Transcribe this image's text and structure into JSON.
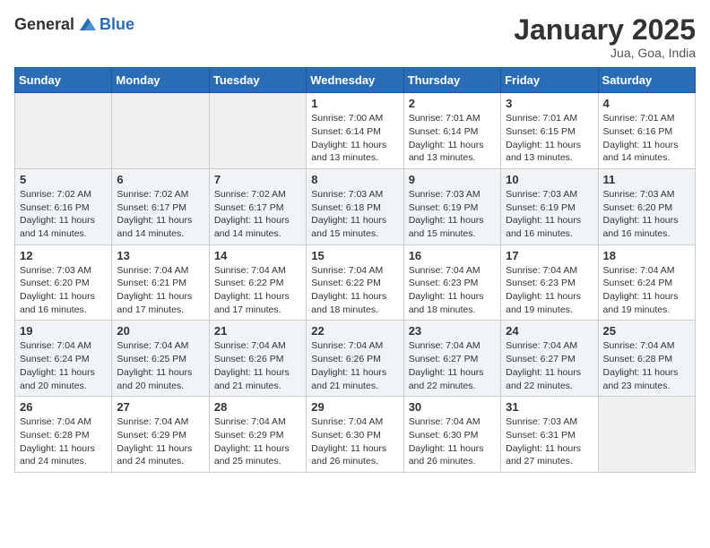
{
  "header": {
    "logo_general": "General",
    "logo_blue": "Blue",
    "month_title": "January 2025",
    "location": "Jua, Goa, India"
  },
  "columns": [
    "Sunday",
    "Monday",
    "Tuesday",
    "Wednesday",
    "Thursday",
    "Friday",
    "Saturday"
  ],
  "weeks": [
    [
      {
        "day": "",
        "sunrise": "",
        "sunset": "",
        "daylight": ""
      },
      {
        "day": "",
        "sunrise": "",
        "sunset": "",
        "daylight": ""
      },
      {
        "day": "",
        "sunrise": "",
        "sunset": "",
        "daylight": ""
      },
      {
        "day": "1",
        "sunrise": "Sunrise: 7:00 AM",
        "sunset": "Sunset: 6:14 PM",
        "daylight": "Daylight: 11 hours and 13 minutes."
      },
      {
        "day": "2",
        "sunrise": "Sunrise: 7:01 AM",
        "sunset": "Sunset: 6:14 PM",
        "daylight": "Daylight: 11 hours and 13 minutes."
      },
      {
        "day": "3",
        "sunrise": "Sunrise: 7:01 AM",
        "sunset": "Sunset: 6:15 PM",
        "daylight": "Daylight: 11 hours and 13 minutes."
      },
      {
        "day": "4",
        "sunrise": "Sunrise: 7:01 AM",
        "sunset": "Sunset: 6:16 PM",
        "daylight": "Daylight: 11 hours and 14 minutes."
      }
    ],
    [
      {
        "day": "5",
        "sunrise": "Sunrise: 7:02 AM",
        "sunset": "Sunset: 6:16 PM",
        "daylight": "Daylight: 11 hours and 14 minutes."
      },
      {
        "day": "6",
        "sunrise": "Sunrise: 7:02 AM",
        "sunset": "Sunset: 6:17 PM",
        "daylight": "Daylight: 11 hours and 14 minutes."
      },
      {
        "day": "7",
        "sunrise": "Sunrise: 7:02 AM",
        "sunset": "Sunset: 6:17 PM",
        "daylight": "Daylight: 11 hours and 14 minutes."
      },
      {
        "day": "8",
        "sunrise": "Sunrise: 7:03 AM",
        "sunset": "Sunset: 6:18 PM",
        "daylight": "Daylight: 11 hours and 15 minutes."
      },
      {
        "day": "9",
        "sunrise": "Sunrise: 7:03 AM",
        "sunset": "Sunset: 6:19 PM",
        "daylight": "Daylight: 11 hours and 15 minutes."
      },
      {
        "day": "10",
        "sunrise": "Sunrise: 7:03 AM",
        "sunset": "Sunset: 6:19 PM",
        "daylight": "Daylight: 11 hours and 16 minutes."
      },
      {
        "day": "11",
        "sunrise": "Sunrise: 7:03 AM",
        "sunset": "Sunset: 6:20 PM",
        "daylight": "Daylight: 11 hours and 16 minutes."
      }
    ],
    [
      {
        "day": "12",
        "sunrise": "Sunrise: 7:03 AM",
        "sunset": "Sunset: 6:20 PM",
        "daylight": "Daylight: 11 hours and 16 minutes."
      },
      {
        "day": "13",
        "sunrise": "Sunrise: 7:04 AM",
        "sunset": "Sunset: 6:21 PM",
        "daylight": "Daylight: 11 hours and 17 minutes."
      },
      {
        "day": "14",
        "sunrise": "Sunrise: 7:04 AM",
        "sunset": "Sunset: 6:22 PM",
        "daylight": "Daylight: 11 hours and 17 minutes."
      },
      {
        "day": "15",
        "sunrise": "Sunrise: 7:04 AM",
        "sunset": "Sunset: 6:22 PM",
        "daylight": "Daylight: 11 hours and 18 minutes."
      },
      {
        "day": "16",
        "sunrise": "Sunrise: 7:04 AM",
        "sunset": "Sunset: 6:23 PM",
        "daylight": "Daylight: 11 hours and 18 minutes."
      },
      {
        "day": "17",
        "sunrise": "Sunrise: 7:04 AM",
        "sunset": "Sunset: 6:23 PM",
        "daylight": "Daylight: 11 hours and 19 minutes."
      },
      {
        "day": "18",
        "sunrise": "Sunrise: 7:04 AM",
        "sunset": "Sunset: 6:24 PM",
        "daylight": "Daylight: 11 hours and 19 minutes."
      }
    ],
    [
      {
        "day": "19",
        "sunrise": "Sunrise: 7:04 AM",
        "sunset": "Sunset: 6:24 PM",
        "daylight": "Daylight: 11 hours and 20 minutes."
      },
      {
        "day": "20",
        "sunrise": "Sunrise: 7:04 AM",
        "sunset": "Sunset: 6:25 PM",
        "daylight": "Daylight: 11 hours and 20 minutes."
      },
      {
        "day": "21",
        "sunrise": "Sunrise: 7:04 AM",
        "sunset": "Sunset: 6:26 PM",
        "daylight": "Daylight: 11 hours and 21 minutes."
      },
      {
        "day": "22",
        "sunrise": "Sunrise: 7:04 AM",
        "sunset": "Sunset: 6:26 PM",
        "daylight": "Daylight: 11 hours and 21 minutes."
      },
      {
        "day": "23",
        "sunrise": "Sunrise: 7:04 AM",
        "sunset": "Sunset: 6:27 PM",
        "daylight": "Daylight: 11 hours and 22 minutes."
      },
      {
        "day": "24",
        "sunrise": "Sunrise: 7:04 AM",
        "sunset": "Sunset: 6:27 PM",
        "daylight": "Daylight: 11 hours and 22 minutes."
      },
      {
        "day": "25",
        "sunrise": "Sunrise: 7:04 AM",
        "sunset": "Sunset: 6:28 PM",
        "daylight": "Daylight: 11 hours and 23 minutes."
      }
    ],
    [
      {
        "day": "26",
        "sunrise": "Sunrise: 7:04 AM",
        "sunset": "Sunset: 6:28 PM",
        "daylight": "Daylight: 11 hours and 24 minutes."
      },
      {
        "day": "27",
        "sunrise": "Sunrise: 7:04 AM",
        "sunset": "Sunset: 6:29 PM",
        "daylight": "Daylight: 11 hours and 24 minutes."
      },
      {
        "day": "28",
        "sunrise": "Sunrise: 7:04 AM",
        "sunset": "Sunset: 6:29 PM",
        "daylight": "Daylight: 11 hours and 25 minutes."
      },
      {
        "day": "29",
        "sunrise": "Sunrise: 7:04 AM",
        "sunset": "Sunset: 6:30 PM",
        "daylight": "Daylight: 11 hours and 26 minutes."
      },
      {
        "day": "30",
        "sunrise": "Sunrise: 7:04 AM",
        "sunset": "Sunset: 6:30 PM",
        "daylight": "Daylight: 11 hours and 26 minutes."
      },
      {
        "day": "31",
        "sunrise": "Sunrise: 7:03 AM",
        "sunset": "Sunset: 6:31 PM",
        "daylight": "Daylight: 11 hours and 27 minutes."
      },
      {
        "day": "",
        "sunrise": "",
        "sunset": "",
        "daylight": ""
      }
    ]
  ]
}
